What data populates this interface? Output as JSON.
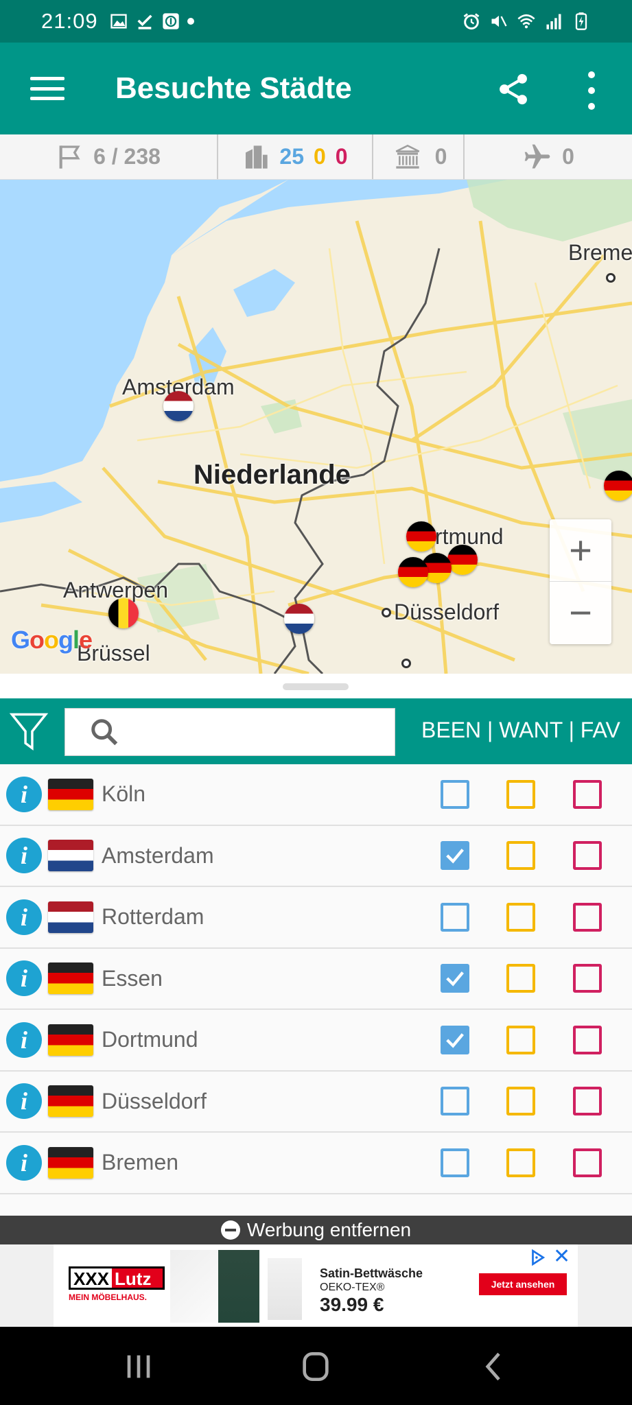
{
  "status_bar": {
    "time": "21:09"
  },
  "app_bar": {
    "title": "Besuchte Städte"
  },
  "stats": {
    "cities": "6 / 238",
    "been": "25",
    "want": "0",
    "fav": "0",
    "unesco": "0",
    "flights": "0",
    "colors": {
      "been": "#5aa6e0",
      "want": "#f5b800",
      "fav": "#d02060"
    }
  },
  "map": {
    "labels": {
      "bremen": "Breme",
      "amsterdam": "Amsterdam",
      "niederlande": "Niederlande",
      "dortmund": "rtmund",
      "antwerpen": "Antwerpen",
      "duesseldorf": "Düsseldorf",
      "bruessel": "Brüssel"
    },
    "google": "Google",
    "zoom_in": "+",
    "zoom_out": "−"
  },
  "filter": {
    "search_placeholder": "",
    "column_header": "BEEN | WANT | FAV"
  },
  "cities": [
    {
      "name": "Köln",
      "country": "de",
      "been": false,
      "want": false,
      "fav": false
    },
    {
      "name": "Amsterdam",
      "country": "nl",
      "been": true,
      "want": false,
      "fav": false
    },
    {
      "name": "Rotterdam",
      "country": "nl",
      "been": false,
      "want": false,
      "fav": false
    },
    {
      "name": "Essen",
      "country": "de",
      "been": true,
      "want": false,
      "fav": false
    },
    {
      "name": "Dortmund",
      "country": "de",
      "been": true,
      "want": false,
      "fav": false
    },
    {
      "name": "Düsseldorf",
      "country": "de",
      "been": false,
      "want": false,
      "fav": false
    },
    {
      "name": "Bremen",
      "country": "de",
      "been": false,
      "want": false,
      "fav": false
    }
  ],
  "ad": {
    "remove_label": "Werbung entfernen",
    "brand_top_a": "XXX",
    "brand_top_b": "Lutz",
    "brand_sub": "MEIN MÖBELHAUS.",
    "line1": "Satin-Bettwäsche",
    "line2": "OEKO-TEX®",
    "price": "39.99 €",
    "cta": "Jetzt ansehen"
  }
}
